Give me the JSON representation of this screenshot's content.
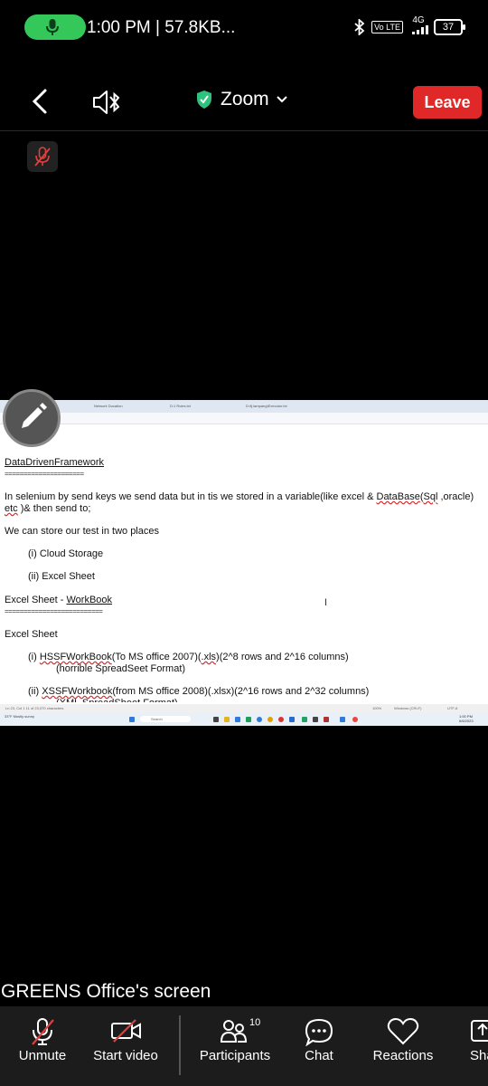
{
  "status": {
    "time_text": "1:00 PM | 57.8KB...",
    "network": "4G",
    "volte": "Vo LTE",
    "battery": "37"
  },
  "meeting": {
    "title": "Zoom",
    "leave_label": "Leave",
    "share_label": "GREENS Office's screen"
  },
  "shared_screen": {
    "tabs": [
      "Dorai Dhana Kumar",
      "Network Ducation",
      "D:1 Roles.txt",
      "D:\\fj.lampang\\Executor.txt"
    ],
    "doc_title": "DataDrivenFramework",
    "sep1": "=====================",
    "para1a": "In selenium by send keys we send data but in tis we stored in a variable(like excel & ",
    "para1_link1": "DataBase",
    "para1b": "(",
    "para1_link2": "Sql",
    "para1c": " ,oracle)",
    "para1d_link": "etc",
    "para1e": " )& then send to;",
    "store_line": "We can store our test in two places",
    "item1": "(i) Cloud Storage",
    "item2": "(ii) Excel Sheet",
    "excel_heading_a": "Excel Sheet - ",
    "excel_heading_b": "WorkBook",
    "sep2": "==========================",
    "excel_sheet": "Excel Sheet",
    "h1_prefix": "(i) ",
    "h1_link": "HSSFWorkBook",
    "h1_mid": "(To MS office 2007)(",
    "h1_link2": ".xls",
    "h1_end": ")(2^8 rows and 2^16 columns)",
    "h1_note": "(horrible SpreadSeet Format)",
    "x1_prefix": "(ii) ",
    "x1_link": "XSSFWorkbook",
    "x1_end": "(from MS office 2008)(.xlsx)(2^16 rows and 2^32 columns)",
    "x1_note": "(XML SpreadSheet Format)",
    "statusline_left": "Ln 23, Col 1    11 of 23,070 characters",
    "statusline_zoom": "100%",
    "statusline_eol": "Windows (CRLF)",
    "statusline_enc": "UTF-8",
    "taskbar_weather": "33°F Mostly sunny",
    "taskbar_search": "Search",
    "taskbar_time": "1:00 PM",
    "taskbar_date": "6/6/2023"
  },
  "toolbar": {
    "unmute": "Unmute",
    "start_video": "Start video",
    "participants": "Participants",
    "participants_count": "10",
    "chat": "Chat",
    "reactions": "Reactions",
    "share": "Sha"
  },
  "colors": {
    "leave": "#e02828",
    "mic_pill": "#34c759",
    "shield": "#2ec27e"
  }
}
